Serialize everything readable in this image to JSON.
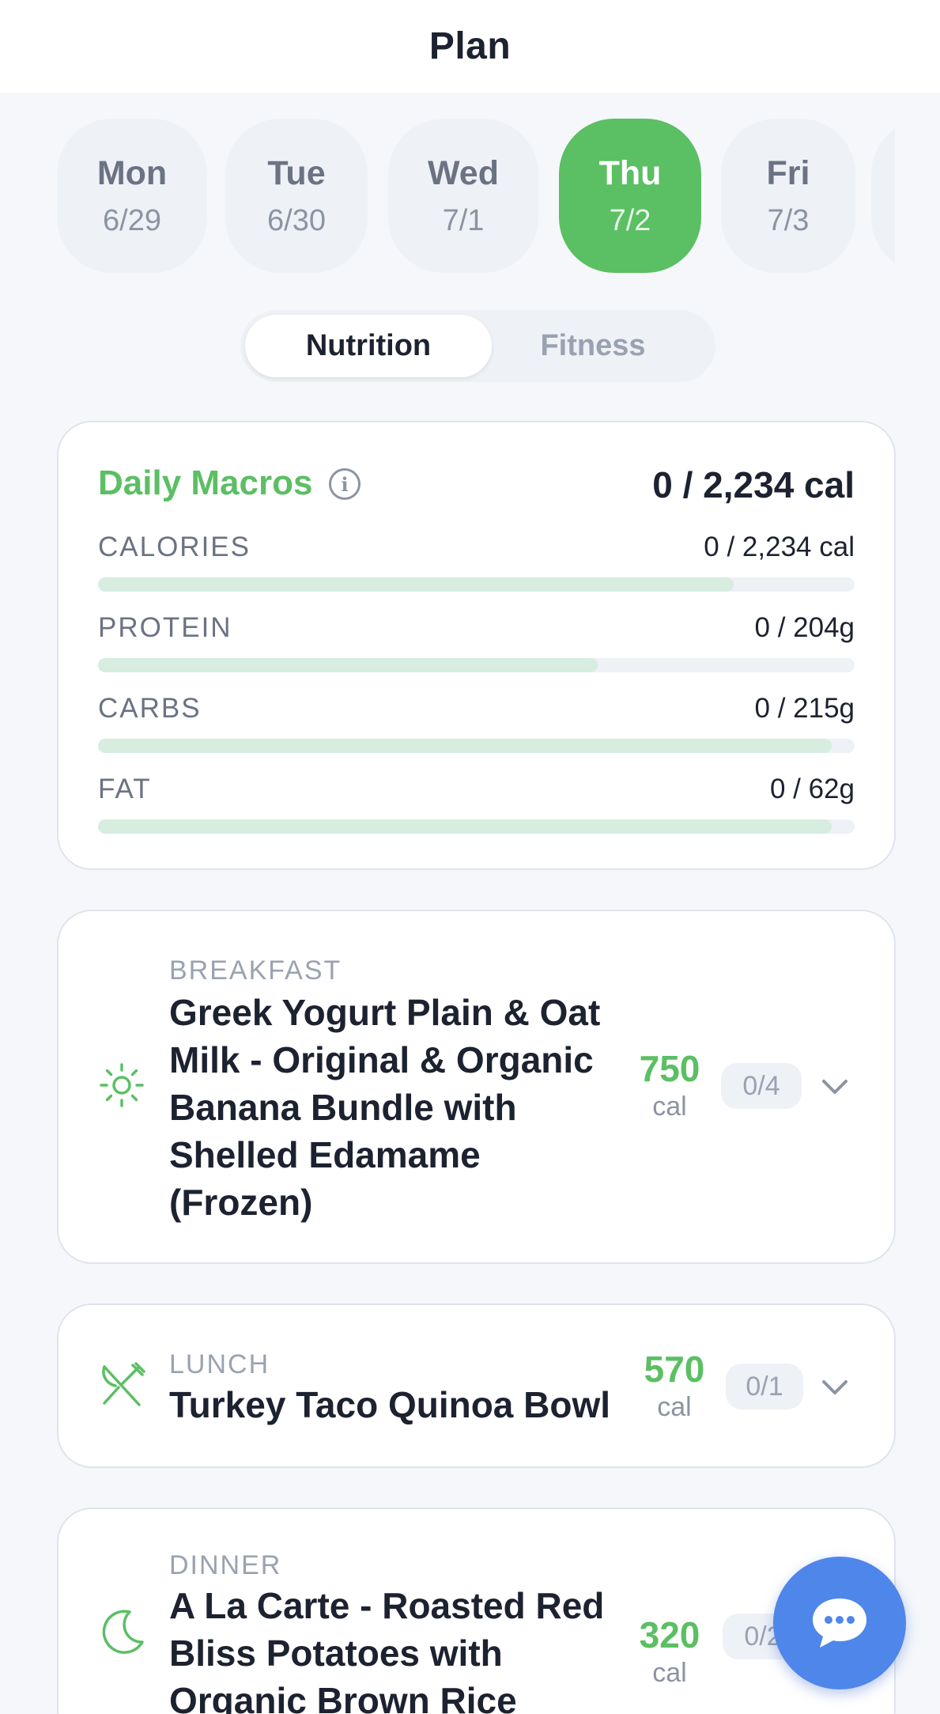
{
  "header": {
    "title": "Plan"
  },
  "days": [
    {
      "name": "Mon",
      "date": "6/29",
      "active": false
    },
    {
      "name": "Tue",
      "date": "6/30",
      "active": false
    },
    {
      "name": "Wed",
      "date": "7/1",
      "active": false
    },
    {
      "name": "Thu",
      "date": "7/2",
      "active": true
    },
    {
      "name": "Fri",
      "date": "7/3",
      "active": false
    }
  ],
  "tabs": {
    "nutrition": "Nutrition",
    "fitness": "Fitness",
    "active": "Nutrition"
  },
  "macros": {
    "title": "Daily Macros",
    "total": "0 / 2,234 cal",
    "rows": [
      {
        "label": "CALORIES",
        "value": "0 / 2,234 cal",
        "fill": 0.84
      },
      {
        "label": "PROTEIN",
        "value": "0 / 204g",
        "fill": 0.66
      },
      {
        "label": "CARBS",
        "value": "0 / 215g",
        "fill": 0.97
      },
      {
        "label": "FAT",
        "value": "0 / 62g",
        "fill": 0.97
      }
    ]
  },
  "meals": {
    "breakfast": {
      "type": "BREAKFAST",
      "name_lines": [
        "Greek Yogurt Plain & Oat",
        "Milk - Original & Organic",
        "Banana Bundle with",
        "Shelled Edamame",
        "(Frozen)"
      ],
      "cal": "750",
      "cal_unit": "cal",
      "count": "0/4",
      "icon": "sun-icon"
    },
    "lunch": {
      "type": "LUNCH",
      "name_lines": [
        "Turkey Taco Quinoa Bowl"
      ],
      "cal": "570",
      "cal_unit": "cal",
      "count": "0/1",
      "icon": "fork-knife-icon"
    },
    "dinner": {
      "type": "DINNER",
      "name_lines": [
        "A La Carte - Roasted Red",
        "Bliss Potatoes with",
        "Organic Brown Rice"
      ],
      "cal": "320",
      "cal_unit": "cal",
      "count": "0/2",
      "icon": "moon-icon"
    }
  },
  "colors": {
    "accent": "#5bbf63",
    "fab": "#4f86ea",
    "background": "#f5f7fb"
  },
  "fab": {
    "icon": "chat-bubble-icon"
  }
}
